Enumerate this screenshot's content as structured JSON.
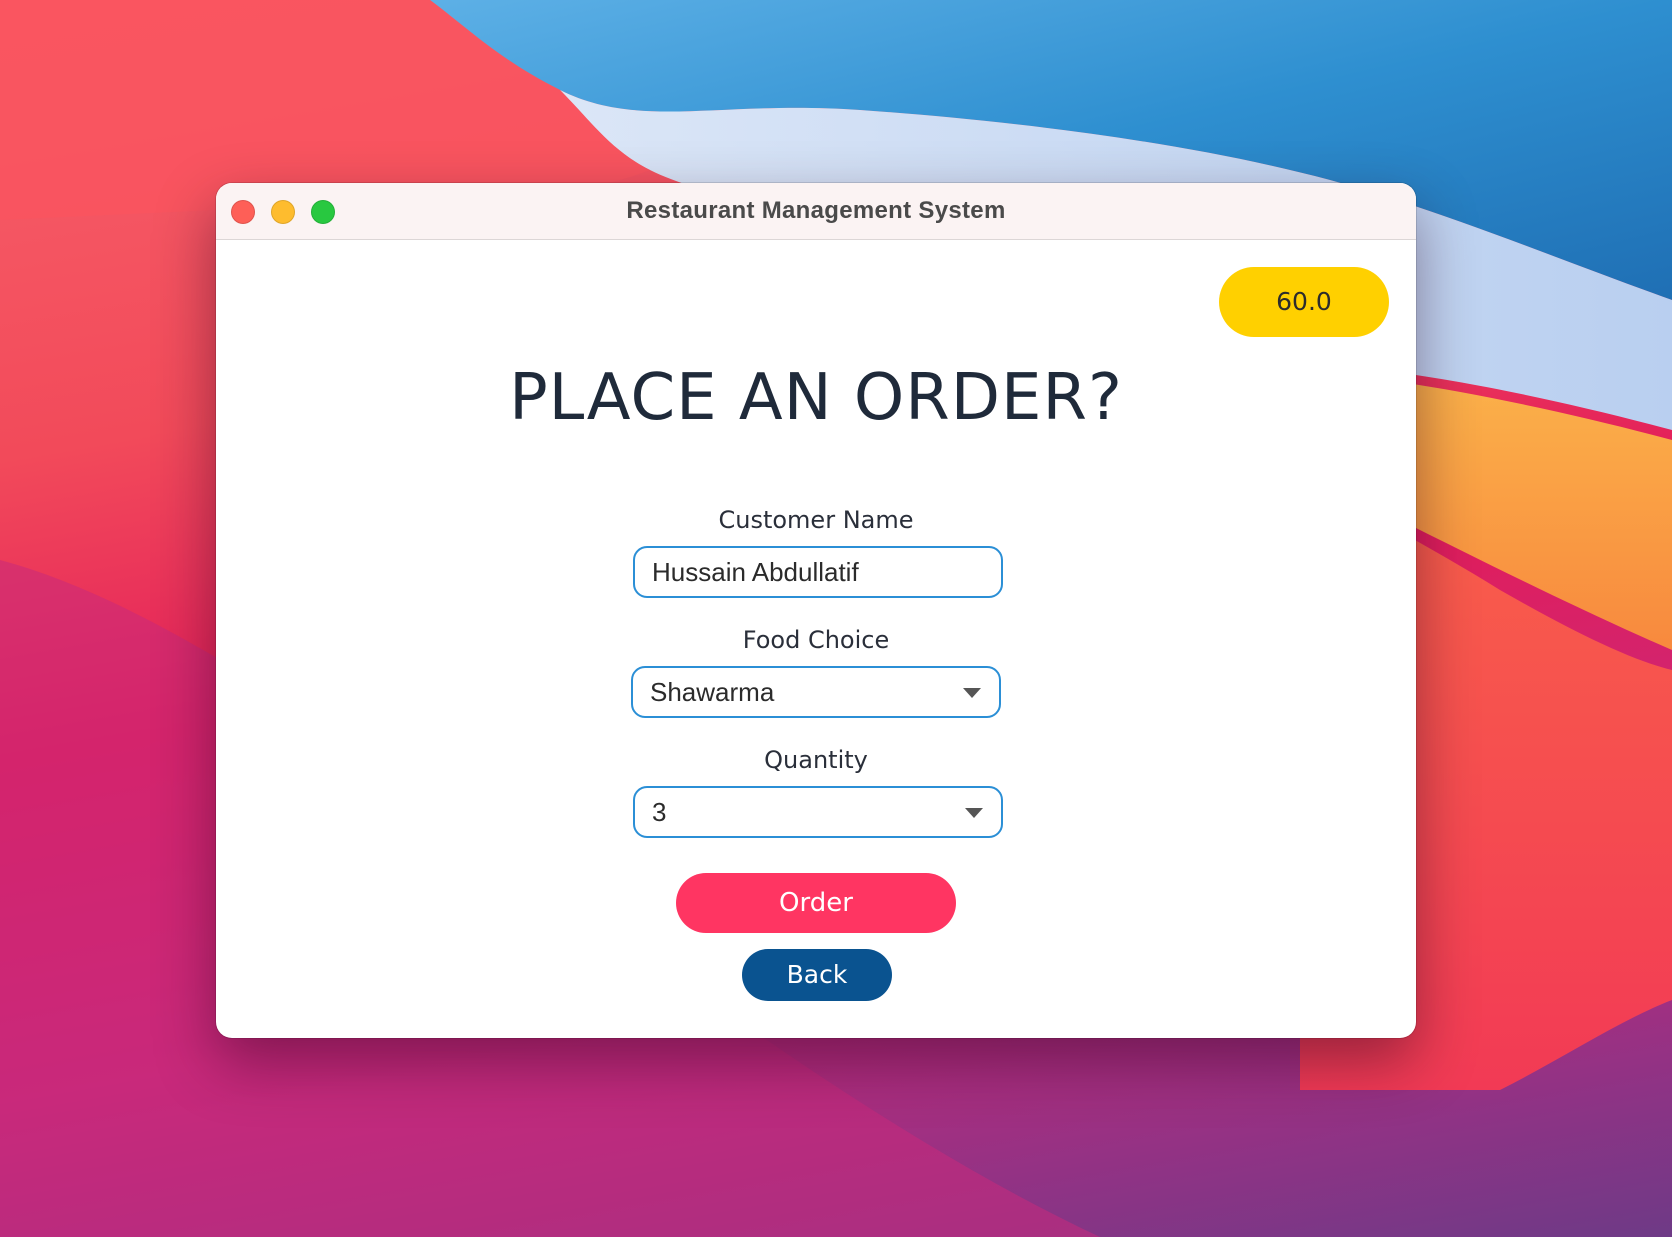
{
  "window": {
    "title": "Restaurant Management System"
  },
  "balance": {
    "value": "60.0",
    "color": "#ffd000"
  },
  "heading": "PLACE AN ORDER?",
  "form": {
    "customer_name": {
      "label": "Customer Name",
      "value": "Hussain Abdullatif"
    },
    "food_choice": {
      "label": "Food Choice",
      "selected": "Shawarma"
    },
    "quantity": {
      "label": "Quantity",
      "selected": "3"
    }
  },
  "buttons": {
    "order_label": "Order",
    "order_color": "#ff3562",
    "back_label": "Back",
    "back_color": "#0a5390"
  },
  "icons": {
    "traffic_lights": [
      "close-icon",
      "minimize-icon",
      "zoom-icon"
    ],
    "dropdown": "chevron-down-icon"
  }
}
